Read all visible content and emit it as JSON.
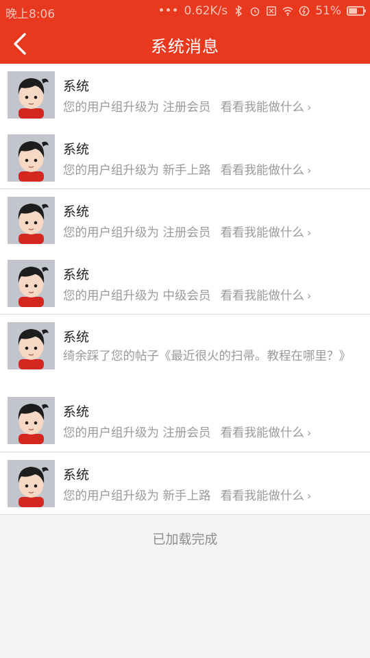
{
  "status": {
    "time": "晚上8:06",
    "dots": "•••",
    "speed": "0.62K/s",
    "battery": "51%"
  },
  "header": {
    "title": "系统消息",
    "back_icon": "back-arrow-icon"
  },
  "messages": [
    {
      "sender": "系统",
      "text": "您的用户组升级为 注册会员",
      "link": "看看我能做什么",
      "chevron": "›"
    },
    {
      "sender": "系统",
      "text": "您的用户组升级为 新手上路",
      "link": "看看我能做什么",
      "chevron": "›"
    },
    {
      "sender": "系统",
      "text": "您的用户组升级为 注册会员",
      "link": "看看我能做什么",
      "chevron": "›"
    },
    {
      "sender": "系统",
      "text": "您的用户组升级为 中级会员",
      "link": "看看我能做什么",
      "chevron": "›"
    },
    {
      "sender": "系统",
      "text": "绮余踩了您的帖子《最近很火的扫帚。教程在哪里？》"
    },
    {
      "sender": "系统",
      "text": "您的用户组升级为 注册会员",
      "link": "看看我能做什么",
      "chevron": "›"
    },
    {
      "sender": "系统",
      "text": "您的用户组升级为 新手上路",
      "link": "看看我能做什么",
      "chevron": "›"
    }
  ],
  "footer": {
    "status": "已加载完成"
  },
  "colors": {
    "primary": "#e8391f",
    "background": "#f4f4f4",
    "text_secondary": "#9a9a9a"
  }
}
